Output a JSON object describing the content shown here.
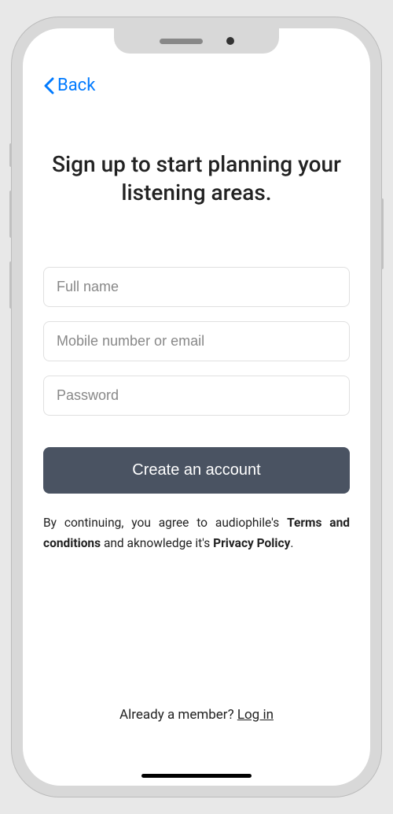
{
  "nav": {
    "back_label": "Back"
  },
  "heading": "Sign up to start planning your listening areas.",
  "form": {
    "fullname_placeholder": "Full name",
    "contact_placeholder": "Mobile number or email",
    "password_placeholder": "Password",
    "submit_label": "Create an account"
  },
  "terms": {
    "prefix": "By continuing, you agree to audiophile's ",
    "terms_label": "Terms and conditions",
    "middle": " and aknowledge it's ",
    "privacy_label": "Privacy Policy",
    "suffix": "."
  },
  "footer": {
    "prompt": "Already a member? ",
    "login_label": "Log in"
  }
}
